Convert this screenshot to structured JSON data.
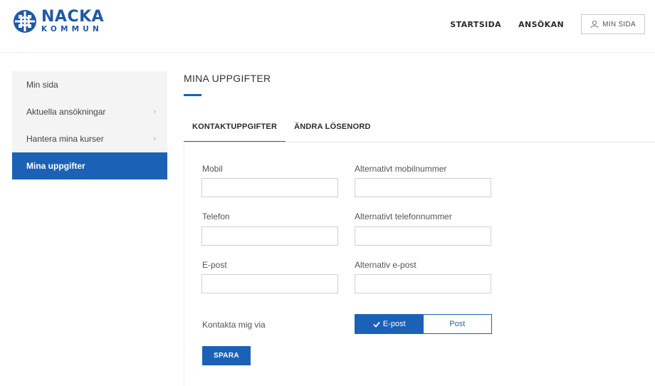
{
  "brand": {
    "name": "NACKA",
    "sub": "KOMMUN",
    "color": "#1f5aa8"
  },
  "topnav": {
    "links": [
      "STARTSIDA",
      "ANSÖKAN"
    ],
    "account_label": "MIN SIDA"
  },
  "sidebar": {
    "items": [
      {
        "label": "Min sida",
        "chevron": false,
        "active": false
      },
      {
        "label": "Aktuella ansökningar",
        "chevron": true,
        "active": false
      },
      {
        "label": "Hantera mina kurser",
        "chevron": true,
        "active": false
      },
      {
        "label": "Mina uppgifter",
        "chevron": false,
        "active": true
      }
    ],
    "chevron_glyph": "›"
  },
  "page": {
    "title": "MINA UPPGIFTER"
  },
  "tabs": [
    {
      "label": "KONTAKTUPPGIFTER",
      "active": true
    },
    {
      "label": "ÄNDRA LÖSENORD",
      "active": false
    }
  ],
  "form": {
    "fields": [
      {
        "label": "Mobil",
        "value": ""
      },
      {
        "label": "Alternativt mobilnummer",
        "value": ""
      },
      {
        "label": "Telefon",
        "value": ""
      },
      {
        "label": "Alternativt telefonnummer",
        "value": ""
      },
      {
        "label": "E-post",
        "value": ""
      },
      {
        "label": "Alternativ e-post",
        "value": ""
      }
    ],
    "contact_via": {
      "label": "Kontakta mig via",
      "options": [
        "E-post",
        "Post"
      ],
      "selected": "E-post"
    },
    "save_label": "SPARA"
  },
  "colors": {
    "accent": "#1b62b7",
    "sidebar_bg": "#f4f4f4"
  }
}
